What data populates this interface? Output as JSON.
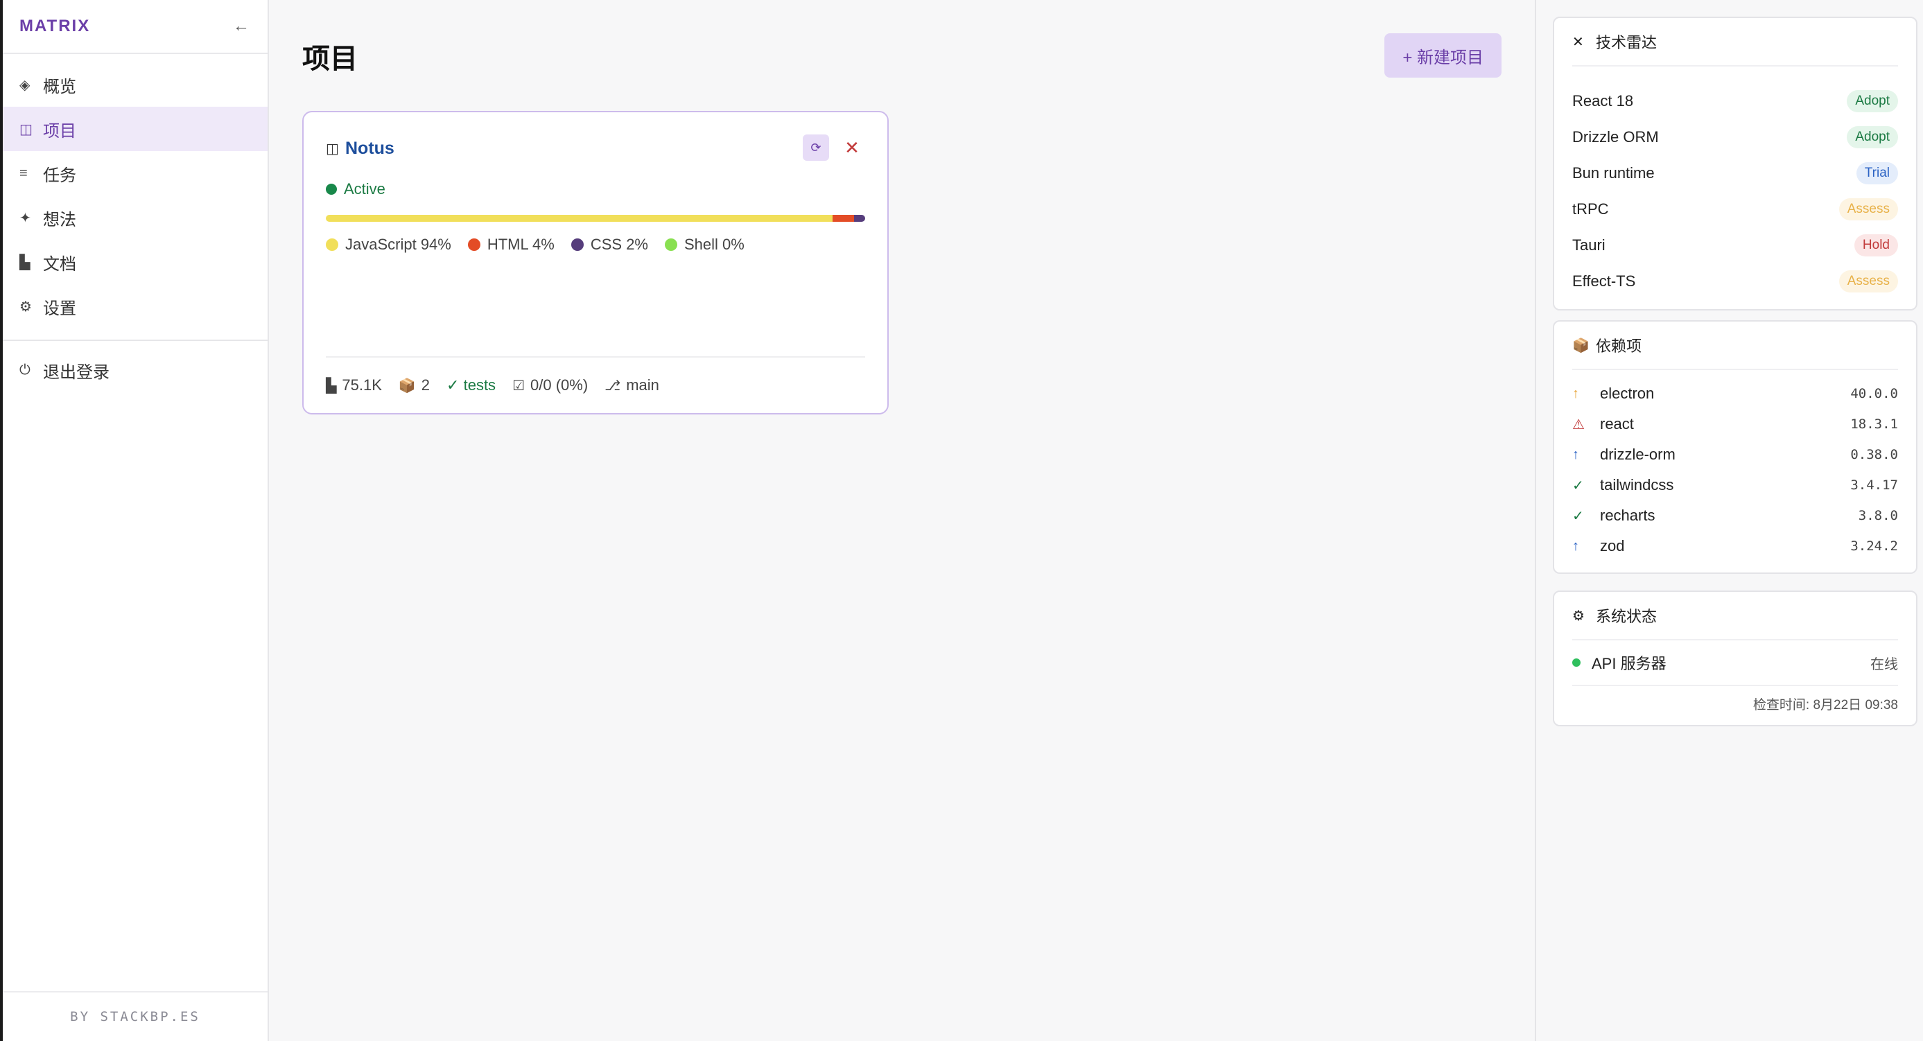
{
  "sidebar": {
    "brand": "MATRIX",
    "collapse_icon": "←",
    "items": [
      {
        "icon": "◈",
        "label": "概览",
        "active": false
      },
      {
        "icon": "◫",
        "label": "项目",
        "active": true
      },
      {
        "icon": "≡",
        "label": "任务",
        "active": false
      },
      {
        "icon": "✦",
        "label": "想法",
        "active": false
      },
      {
        "icon": "▙",
        "label": "文档",
        "active": false
      },
      {
        "icon": "⚙",
        "label": "设置",
        "active": false
      }
    ],
    "logout": {
      "icon": "⏻",
      "label": "退出登录"
    },
    "footer": "BY STACKBP.ES"
  },
  "main": {
    "title": "项目",
    "new_button": "+ 新建项目",
    "project": {
      "icon": "◫",
      "name": "Notus",
      "status": "Active",
      "sync_icon": "⟳",
      "close_icon": "✕",
      "languages": [
        {
          "name": "JavaScript",
          "percent": 94,
          "label": "JavaScript 94%",
          "color": "#f1df5a"
        },
        {
          "name": "HTML",
          "percent": 4,
          "label": "HTML 4%",
          "color": "#e34c26"
        },
        {
          "name": "CSS",
          "percent": 2,
          "label": "CSS 2%",
          "color": "#563d7c"
        },
        {
          "name": "Shell",
          "percent": 0,
          "label": "Shell 0%",
          "color": "#89e051"
        }
      ],
      "footer": {
        "size_icon": "▙",
        "size": "75.1K",
        "packages_icon": "📦",
        "packages": "2",
        "tests": "✓ tests",
        "tasks_icon": "☑",
        "tasks": "0/0 (0%)",
        "branch_icon": "⎇",
        "branch": "main"
      }
    }
  },
  "radar": {
    "icon": "✕",
    "title": "技术雷达",
    "items": [
      {
        "name": "React 18",
        "ring": "Adopt",
        "color": "#1b7a43",
        "bg": "#e4f5ea"
      },
      {
        "name": "Drizzle ORM",
        "ring": "Adopt",
        "color": "#1b7a43",
        "bg": "#e4f5ea"
      },
      {
        "name": "Bun runtime",
        "ring": "Trial",
        "color": "#2c63c4",
        "bg": "#e4edfb"
      },
      {
        "name": "tRPC",
        "ring": "Assess",
        "color": "#e8b24a",
        "bg": "#fdf4e2"
      },
      {
        "name": "Tauri",
        "ring": "Hold",
        "color": "#c23b3b",
        "bg": "#fbe6e6"
      },
      {
        "name": "Effect-TS",
        "ring": "Assess",
        "color": "#e8b24a",
        "bg": "#fdf4e2"
      }
    ]
  },
  "deps": {
    "icon": "📦",
    "title": "依赖项",
    "items": [
      {
        "name": "electron",
        "version": "40.0.0",
        "icon": "↑",
        "color": "#e8a53a"
      },
      {
        "name": "react",
        "version": "18.3.1",
        "icon": "⚠",
        "color": "#c23b3b"
      },
      {
        "name": "drizzle-orm",
        "version": "0.38.0",
        "icon": "↑",
        "color": "#2c63c4"
      },
      {
        "name": "tailwindcss",
        "version": "3.4.17",
        "icon": "✓",
        "color": "#1b7a43"
      },
      {
        "name": "recharts",
        "version": "3.8.0",
        "icon": "✓",
        "color": "#1b7a43"
      },
      {
        "name": "zod",
        "version": "3.24.2",
        "icon": "↑",
        "color": "#2c63c4"
      }
    ]
  },
  "system": {
    "icon": "⚙",
    "title": "系统状态",
    "service": "API 服务器",
    "service_status": "在线",
    "checked": "检查时间: 8月22日 09:38"
  }
}
